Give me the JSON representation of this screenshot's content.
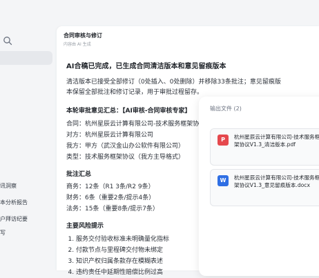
{
  "sidebar": {
    "items": [
      {
        "label": "讯洞察"
      },
      {
        "label": "本分析报告"
      },
      {
        "label": "户拜访纪要"
      },
      {
        "label": "写"
      }
    ]
  },
  "chat": {
    "title": "合同审核与修订",
    "subtitle": "内容由 AI 生成",
    "heading": "AI合稿已完成，已生成合同清洁版本和意见留痕版本",
    "intro": "清洁版本已接受全部修订（0处插入、0处删除）并移除33条批注；意见留痕版本保留全部批注和修订记录，用于审批过程留存。",
    "round_title": "本轮审批意见汇总：【AI审核-合同审核专家】",
    "parties": [
      "合同：杭州星辰云计算有限公司-技术服务框架协",
      "对方：杭州星辰云计算有限公司",
      "我方：甲方（武汉金山办公软件有限公司）",
      "类型：技术服务框架协议（我方主导格式）"
    ],
    "summary_title": "批注汇总",
    "summary": [
      "商务：12条（R1 3条/R2 9条）",
      "财务：6条（重要2条/提示4条）",
      "法务：15条（重要8条/提示7条）"
    ],
    "risk_title": "主要风险提示",
    "risks": [
      "服务交付验收标准未明确量化指标",
      "付款节点与里程碑交付物未绑定",
      "知识产权归属条款存在模糊表述",
      "违约责任中延期性赔偿比例过高"
    ]
  },
  "files": {
    "header": "输出文件 (2)",
    "items": [
      {
        "icon": "pdf-file-icon",
        "glyph": "P",
        "color": "#e5484d",
        "name": "杭州星辰云计算有限公司-技术服务框架协议V1.3_清洁版本.pdf"
      },
      {
        "icon": "word-file-icon",
        "glyph": "W",
        "color": "#2f6fe4",
        "name": "杭州星辰云计算有限公司-技术服务框架协议V1.3_意见留痕版本.docx"
      }
    ]
  }
}
